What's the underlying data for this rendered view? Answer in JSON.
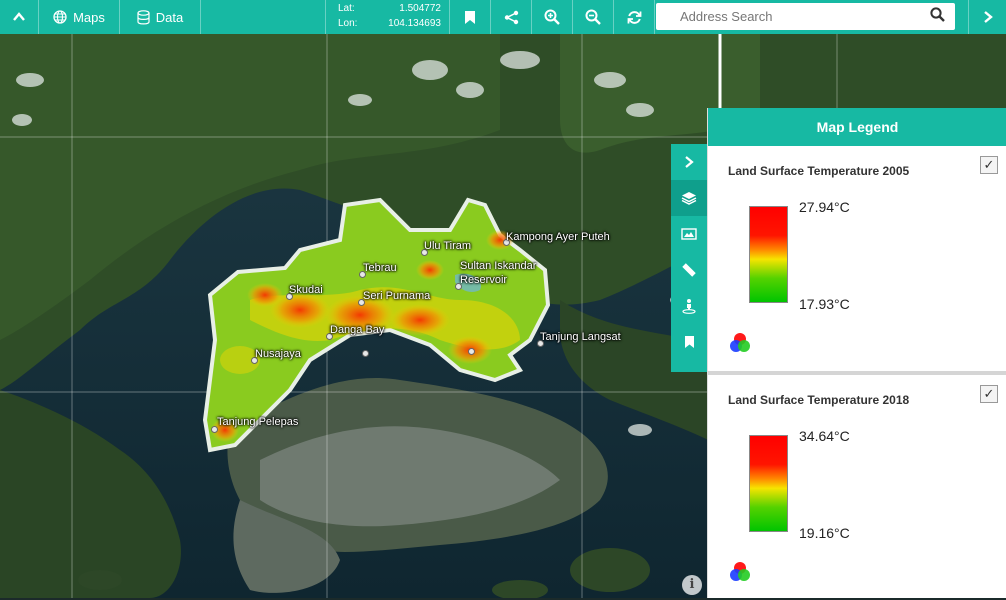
{
  "toolbar": {
    "maps_label": "Maps",
    "data_label": "Data",
    "lat_label": "Lat:",
    "lat_value": "1.504772",
    "lon_label": "Lon:",
    "lon_value": "104.134693",
    "search_placeholder": "Address Search",
    "accent_color": "#17b9a3"
  },
  "map": {
    "places": [
      "Ulu Tiram",
      "Kampong Ayer Puteh",
      "Tebrau",
      "Sultan Iskandar",
      "Reservoir",
      "Skudai",
      "Seri Purnama",
      "Danga Bay",
      "Tanjung Langsat",
      "Nusajaya",
      "Tanjung Pelepas"
    ],
    "info_icon": "info-icon"
  },
  "side_tools": [
    "chevron-right-icon",
    "layers-icon",
    "map-image-icon",
    "ruler-icon",
    "person-pin-icon",
    "bookmark-icon"
  ],
  "legend": {
    "title": "Map Legend",
    "layers": [
      {
        "title": "Land Surface Temperature 2005",
        "max": "27.94°C",
        "min": "17.93°C",
        "checked": true
      },
      {
        "title": "Land Surface Temperature 2018",
        "max": "34.64°C",
        "min": "19.16°C",
        "checked": true
      }
    ]
  }
}
